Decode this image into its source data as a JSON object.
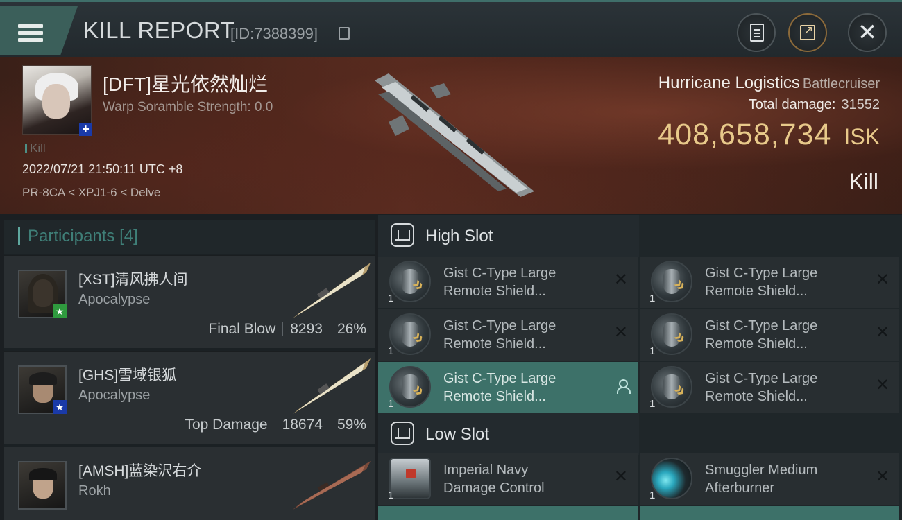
{
  "header": {
    "title": "KILL REPORT",
    "report_id": "[ID:7388399]",
    "icons": [
      "menu-icon",
      "copy-icon",
      "clipboard-icon",
      "share-icon",
      "close-icon"
    ]
  },
  "victim": {
    "pilot_name": "[DFT]星光依然灿烂",
    "warp_scramble": "Warp Soramble Strength: 0.0",
    "tag": "Kill",
    "datetime": "2022/07/21 21:50:11 UTC +8",
    "location": "PR-8CA < XPJ1-6 < Delve",
    "ship_name": "Hurricane Logistics",
    "ship_class": "Battlecruiser",
    "total_damage_label": "Total damage:",
    "total_damage_value": "31552",
    "isk_value": "408,658,734",
    "isk_unit": "ISK",
    "result": "Kill"
  },
  "participants": {
    "title": "Participants",
    "count": "[4]",
    "items": [
      {
        "name": "[XST]清风拂人间",
        "ship": "Apocalypse",
        "label": "Final Blow",
        "damage": "8293",
        "percent": "26%",
        "badge_color": "#2f9a3e"
      },
      {
        "name": "[GHS]雪域银狐",
        "ship": "Apocalypse",
        "label": "Top Damage",
        "damage": "18674",
        "percent": "59%",
        "badge_color": "#1a3aa8"
      },
      {
        "name": "[AMSH]蓝染沢右介",
        "ship": "Rokh",
        "label": "",
        "damage": "",
        "percent": ""
      }
    ]
  },
  "fittings": {
    "high_slot": {
      "title": "High Slot",
      "modules": [
        {
          "line1": "Gist C-Type Large",
          "line2": "Remote Shield...",
          "qty": "1"
        },
        {
          "line1": "Gist C-Type Large",
          "line2": "Remote Shield...",
          "qty": "1"
        },
        {
          "line1": "Gist C-Type Large",
          "line2": "Remote Shield...",
          "qty": "1"
        },
        {
          "line1": "Gist C-Type Large",
          "line2": "Remote Shield...",
          "qty": "1"
        },
        {
          "line1": "Gist C-Type Large",
          "line2": "Remote Shield...",
          "qty": "1"
        },
        {
          "line1": "Gist C-Type Large",
          "line2": "Remote Shield...",
          "qty": "1"
        }
      ]
    },
    "low_slot": {
      "title": "Low Slot",
      "modules": [
        {
          "line1": "Imperial Navy",
          "line2": "Damage Control",
          "qty": "1"
        },
        {
          "line1": "Smuggler Medium",
          "line2": "Afterburner",
          "qty": "1"
        }
      ]
    }
  },
  "colors": {
    "accent": "#3f6f6a",
    "isk": "#e8c98a",
    "active_module": "#3d7169"
  }
}
